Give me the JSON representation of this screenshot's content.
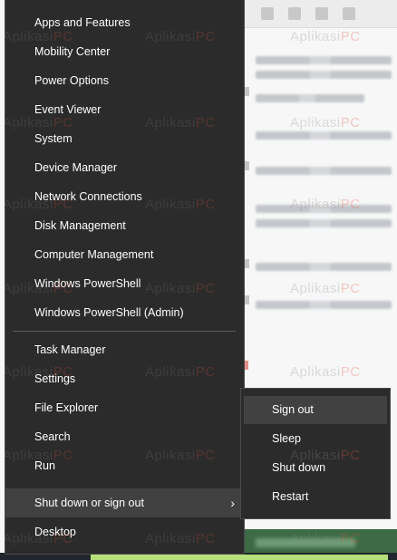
{
  "winx_menu": {
    "group1": [
      "Apps and Features",
      "Mobility Center",
      "Power Options",
      "Event Viewer",
      "System",
      "Device Manager",
      "Network Connections",
      "Disk Management",
      "Computer Management",
      "Windows PowerShell",
      "Windows PowerShell (Admin)"
    ],
    "group2": [
      "Task Manager",
      "Settings",
      "File Explorer",
      "Search",
      "Run"
    ],
    "shutdown_label": "Shut down or sign out",
    "desktop_label": "Desktop",
    "chevron_icon": "chevron-right-icon"
  },
  "submenu": {
    "items": [
      "Sign out",
      "Sleep",
      "Shut down",
      "Restart"
    ],
    "highlighted": "Sign out"
  },
  "watermark": {
    "prefix": "Aplikasi",
    "suffix": "PC"
  },
  "colors": {
    "menu_bg": "#2b2b2b",
    "menu_highlight": "#414141",
    "menu_text": "#ffffff",
    "watermark_accent": "#e85a46"
  }
}
